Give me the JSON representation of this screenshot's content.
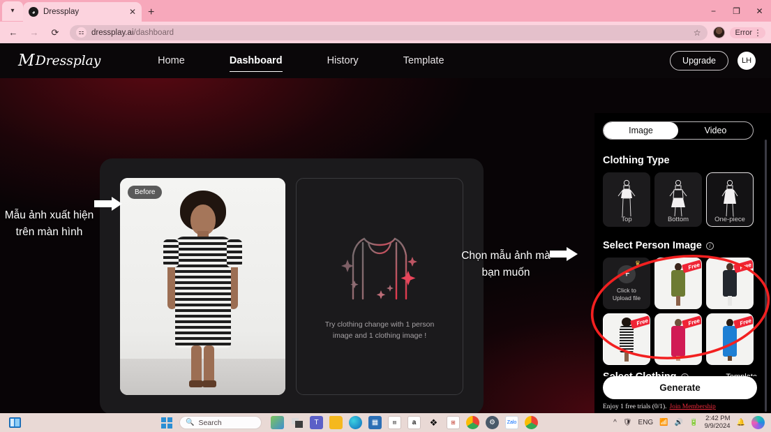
{
  "browser": {
    "tab": {
      "title": "Dressplay",
      "favicon_icon": "dressplay-favicon",
      "close_icon": "close-icon"
    },
    "tab_list_icon": "chevron-down-icon",
    "new_tab_icon": "plus-icon",
    "window_controls": {
      "minimize": "−",
      "maximize": "❐",
      "close": "✕"
    },
    "nav": {
      "back_icon": "←",
      "forward_icon": "→",
      "reload_icon": "⟳"
    },
    "omnibox": {
      "site_settings_icon": "tune-icon",
      "url_host": "dressplay.ai",
      "url_path": "/dashboard",
      "bookmark_icon": "star-icon"
    },
    "profile_icon": "profile-avatar",
    "error_badge": "Error",
    "menu_icon": "kebab-menu-icon"
  },
  "app": {
    "logo": {
      "mark": "M",
      "text": "Dressplay"
    },
    "nav_links": [
      {
        "label": "Home",
        "active": false
      },
      {
        "label": "Dashboard",
        "active": true
      },
      {
        "label": "History",
        "active": false
      },
      {
        "label": "Template",
        "active": false
      }
    ],
    "upgrade_label": "Upgrade",
    "avatar_initials": "LH"
  },
  "workspace": {
    "before_badge": "Before",
    "empty_state_text": "Try clothing change with 1 person image and 1 clothing image !"
  },
  "panel": {
    "mode_tabs": [
      {
        "label": "Image",
        "active": true
      },
      {
        "label": "Video",
        "active": false
      }
    ],
    "clothing_type": {
      "title": "Clothing Type",
      "options": [
        {
          "label": "Top",
          "active": false
        },
        {
          "label": "Bottom",
          "active": false
        },
        {
          "label": "One-piece",
          "active": true
        }
      ]
    },
    "person_image": {
      "title": "Select Person Image",
      "info_icon": "info-icon",
      "upload": {
        "label_line1": "Click to",
        "label_line2": "Upload file",
        "plus_icon": "plus-icon",
        "premium_icon": "crown-icon"
      },
      "thumbnails": [
        {
          "badge": "Free",
          "selected": false,
          "dress_color": "#6d7b33",
          "skin": "#8a6148"
        },
        {
          "badge": "Free",
          "selected": false,
          "dress_color": "#23272e",
          "skin": "#55392a"
        },
        {
          "badge": "Free",
          "selected": true,
          "dress_color": "#262626",
          "skin": "#7a5236"
        },
        {
          "badge": "Free",
          "selected": false,
          "dress_color": "#d11b54",
          "skin": "#caa288"
        },
        {
          "badge": "Free",
          "selected": false,
          "dress_color": "#1e7fd4",
          "skin": "#4e3323"
        }
      ]
    },
    "clothing": {
      "title": "Select Clothing",
      "info_icon": "info-icon",
      "template_link": "Template"
    },
    "generate_label": "Generate",
    "trial_text": "Enjoy 1 free trials (0/1).",
    "trial_link": "Join Membership",
    "accent_color": "#ee2b3c"
  },
  "annotations": {
    "note_1": "Mẫu ảnh xuất hiện trên màn hình",
    "note_2": "Chọn mẫu ảnh mà bạn muốn",
    "highlight_color": "#f22020"
  },
  "taskbar": {
    "start_icon": "windows-start-icon",
    "search_placeholder": "Search",
    "search_icon": "search-icon",
    "apps": [
      "widgets-icon",
      "task-view-icon",
      "teams-icon",
      "file-explorer-icon",
      "edge-icon",
      "microsoft-store-icon",
      "amazon-icon",
      "amazon-a-icon",
      "dropbox-icon",
      "app-icon",
      "chrome-icon",
      "settings-icon",
      "zalo-icon",
      "chrome-active-icon"
    ],
    "tray": {
      "overflow_icon": "chevron-up-icon",
      "security_icon": "security-alert-icon",
      "language": "ENG",
      "wifi_icon": "wifi-icon",
      "volume_icon": "volume-icon",
      "battery_icon": "battery-icon",
      "time": "2:42 PM",
      "date": "9/9/2024",
      "notification_icon": "bell-icon",
      "copilot_icon": "copilot-icon"
    }
  }
}
